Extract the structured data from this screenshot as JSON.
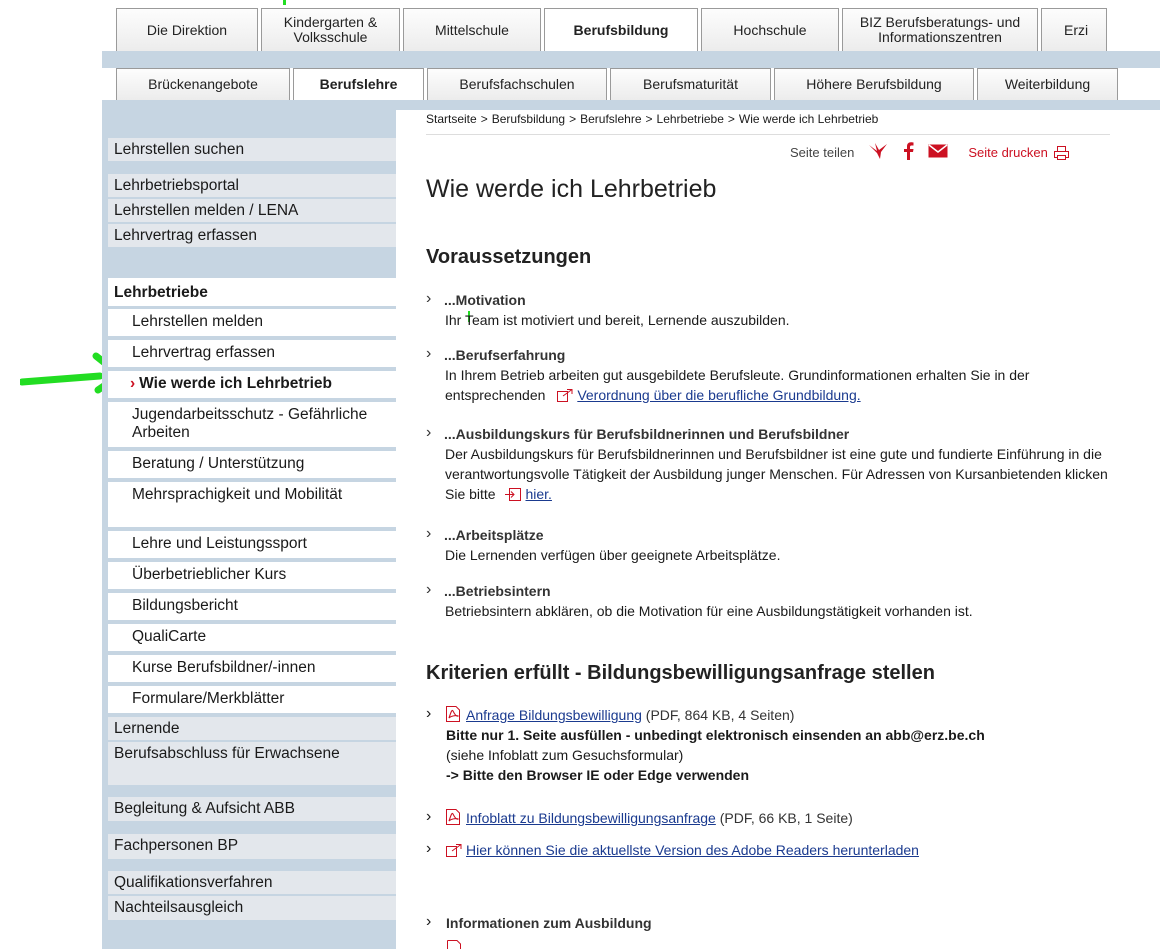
{
  "colors": {
    "nav_band": "#c6d5e2",
    "sidebar_item": "#e3e7ec",
    "accent_red": "#cc1122",
    "link": "#1a3a8f",
    "annotation_green": "#22dd22"
  },
  "top_tabs": [
    {
      "label": "Die Direktion"
    },
    {
      "label": "Kindergarten & Volksschule"
    },
    {
      "label": "Mittelschule"
    },
    {
      "label": "Berufsbildung",
      "active": true
    },
    {
      "label": "Hochschule"
    },
    {
      "label": "BIZ Berufsberatungs- und Informationszentren"
    },
    {
      "label": "Erzi"
    }
  ],
  "sub_tabs": [
    {
      "label": "Brückenangebote"
    },
    {
      "label": "Berufslehre",
      "active": true
    },
    {
      "label": "Berufsfachschulen"
    },
    {
      "label": "Berufsmaturität"
    },
    {
      "label": "Höhere Berufsbildung"
    },
    {
      "label": "Weiterbildung"
    }
  ],
  "sidebar": {
    "top_items": [
      "Lehrstellen suchen",
      "Lehrbetriebsportal",
      "Lehrstellen melden / LENA",
      "Lehrvertrag erfassen"
    ],
    "section": "Lehrbetriebe",
    "sub_items": [
      "Lehrstellen melden",
      "Lehrvertrag erfassen",
      "Wie werde ich Lehrbetrieb",
      "Jugendarbeitsschutz - Gefährliche Arbeiten",
      "Beratung / Unterstützung",
      "Mehrsprachigkeit und Mobilität",
      "Lehre und Leistungssport",
      "Überbetrieblicher Kurs",
      "Bildungsbericht",
      "QualiCarte",
      "Kurse Berufsbildner/-innen",
      "Formulare/Merkblätter"
    ],
    "current_caret": "›",
    "bottom_items": [
      "Lernende",
      "Berufsabschluss für Erwachsene",
      "Begleitung & Aufsicht ABB",
      "Fachpersonen BP",
      "Qualifikationsverfahren",
      "Nachteilsausgleich"
    ]
  },
  "breadcrumb": [
    "Startseite",
    "Berufsbildung",
    "Berufslehre",
    "Lehrbetriebe",
    "Wie werde ich Lehrbetrieb"
  ],
  "breadcrumb_sep": ">",
  "share": {
    "label": "Seite teilen",
    "icons": [
      "bird-icon",
      "facebook-icon",
      "mail-icon"
    ],
    "print_label": "Seite drucken",
    "print_icon": "printer-icon"
  },
  "page_title": "Wie werde ich Lehrbetrieb",
  "requirements": {
    "heading": "Voraussetzungen",
    "items": [
      {
        "title": "...Motivation",
        "text": "Ihr Team ist motiviert und bereit, Lernende auszubilden."
      },
      {
        "title": "...Berufserfahrung",
        "text": "In Ihrem Betrieb arbeiten gut ausgebildete Berufsleute. Grundinformationen erhalten Sie in der entsprechenden",
        "link": "Verordnung über die berufliche Grundbildung."
      },
      {
        "title": "...Ausbildungskurs für Berufsbildnerinnen und Berufsbildner",
        "text": "Der Ausbildungskurs für Berufsbildnerinnen und Berufsbildner ist eine gute und fundierte Einführung in die verantwortungsvolle Tätigkeit der Ausbildung junger Menschen. Für Adressen von Kursanbietenden klicken Sie bitte",
        "link": "hier."
      },
      {
        "title": "...Arbeitsplätze",
        "text": "Die Lernenden verfügen über geeignete Arbeitsplätze."
      },
      {
        "title": "...Betriebsintern",
        "text": "Betriebsintern abklären, ob die Motivation für eine Ausbildungstätigkeit vorhanden ist."
      }
    ]
  },
  "criteria": {
    "heading": "Kriterien erfüllt - Bildungsbewilligungsanfrage stellen",
    "d1_link": "Anfrage Bildungsbewilligung",
    "d1_meta": "(PDF, 864 KB, 4 Seiten)",
    "d1_note1": "Bitte nur 1. Seite ausfüllen - unbedingt elektronisch einsenden an abb@erz.be.ch",
    "d1_note2": "(siehe Infoblatt zum Gesuchsformular)",
    "d1_note3": "-> Bitte den Browser IE oder Edge verwenden",
    "d2_link": "Infoblatt zu Bildungsbewilligungsanfrage",
    "d2_meta": "(PDF, 66 KB, 1 Seite)",
    "d3_link": "Hier können Sie die aktuellste Version des Adobe Readers herunterladen"
  },
  "info_title": "Informationen zum Ausbildung"
}
